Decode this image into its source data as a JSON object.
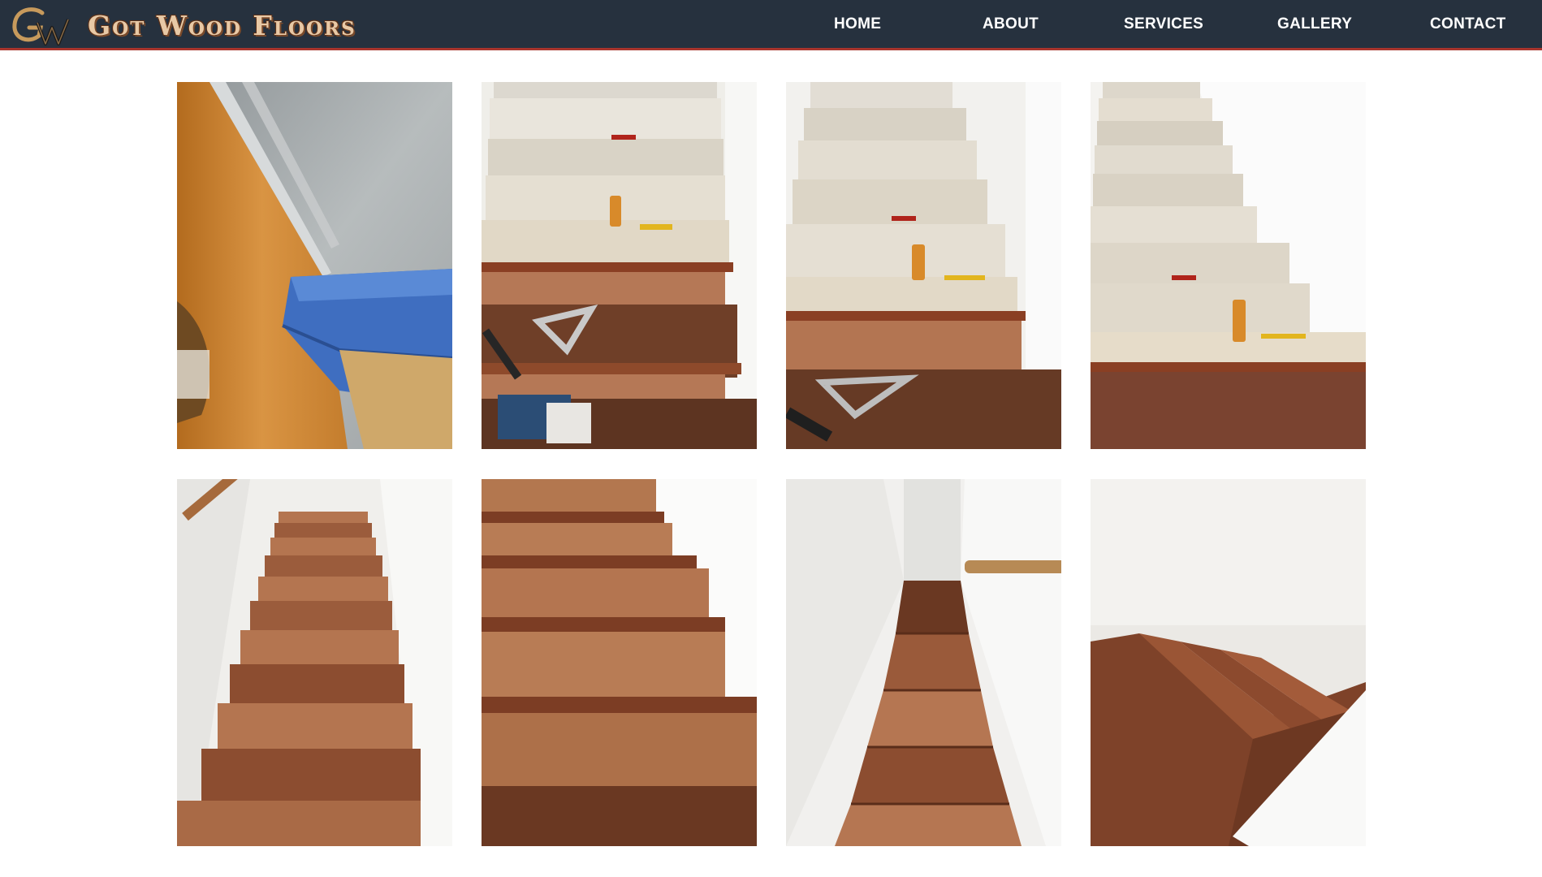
{
  "header": {
    "brand_name": "Got Wood Floors",
    "logo_monogram": "GW"
  },
  "nav": {
    "items": [
      {
        "label": "HOME"
      },
      {
        "label": "ABOUT"
      },
      {
        "label": "SERVICES"
      },
      {
        "label": "GALLERY"
      },
      {
        "label": "CONTACT"
      }
    ]
  },
  "gallery": {
    "images": [
      {
        "subject": "stair-skirt-tile-corner"
      },
      {
        "subject": "stairs-work-in-progress-lower"
      },
      {
        "subject": "stairs-work-in-progress-mid"
      },
      {
        "subject": "stairs-work-in-progress-upper"
      },
      {
        "subject": "finished-stairs-looking-up"
      },
      {
        "subject": "finished-stair-treads-closeup"
      },
      {
        "subject": "finished-stairs-looking-down"
      },
      {
        "subject": "finished-stairs-turn"
      }
    ]
  },
  "colors": {
    "navbar_bg": "#26313e",
    "navbar_border": "#a8352d",
    "nav_text": "#ffffff",
    "brand_text": "#e8c9a6"
  }
}
